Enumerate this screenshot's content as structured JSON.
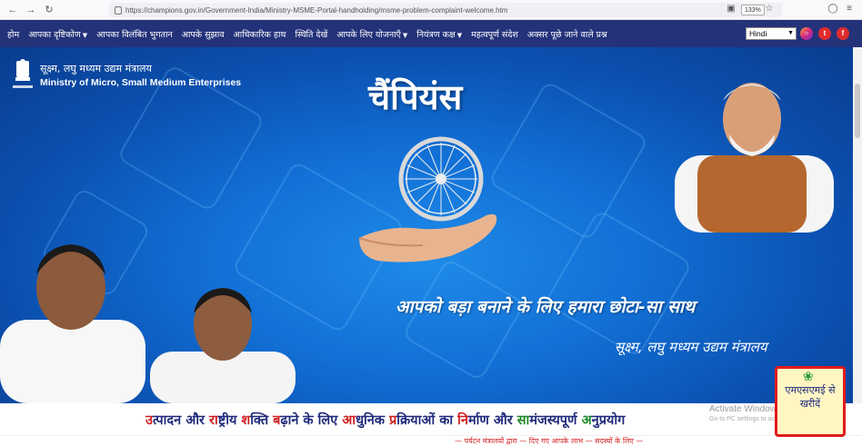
{
  "browser": {
    "url": "https://champions.gov.in/Government-India/Ministry-MSME-Portal-handholding/msme-problem-complaint-welcome.htm",
    "zoom": "133%"
  },
  "nav": {
    "items": [
      "होम",
      "आपका दृष्टिकोण",
      "आपका विलंबित भुगतान",
      "आपके सुझाव",
      "आधिकारिक हाथ",
      "स्थिति देखें",
      "आपके लिए योजनाएँ",
      "नियंत्रण कक्ष",
      "महत्वपूर्ण संदेश",
      "अक्सर पूछे जाने वाले प्रश्न"
    ],
    "language": "Hindi"
  },
  "hero": {
    "ministry_hi": "सूक्ष्म, लघु मध्यम उद्यम मंत्रालय",
    "ministry_en": "Ministry of Micro, Small Medium Enterprises",
    "logo_text": "सत्यमेव जयते",
    "title": "चैंपियंस",
    "tagline": "आपको बड़ा बनाने के लिए हमारा छोटा-सा साथ",
    "sub_tagline": "सूक्ष्म, लघु मध्यम उद्यम मंत्रालय"
  },
  "slogan": [
    {
      "t": "उ",
      "c": "r"
    },
    {
      "t": "त्पादन और ",
      "c": "b"
    },
    {
      "t": "रा",
      "c": "r"
    },
    {
      "t": "ष्ट्रीय ",
      "c": "b"
    },
    {
      "t": "श",
      "c": "r"
    },
    {
      "t": "क्ति ",
      "c": "b"
    },
    {
      "t": "ब",
      "c": "r"
    },
    {
      "t": "ढ़ाने के लिए ",
      "c": "b"
    },
    {
      "t": "आ",
      "c": "r"
    },
    {
      "t": "धुनिक ",
      "c": "b"
    },
    {
      "t": "प्र",
      "c": "r"
    },
    {
      "t": "क्रियाओं का ",
      "c": "b"
    },
    {
      "t": "नि",
      "c": "r"
    },
    {
      "t": "र्माण और ",
      "c": "b"
    },
    {
      "t": "सा",
      "c": "g"
    },
    {
      "t": "मंजस्यपूर्ण ",
      "c": "b"
    },
    {
      "t": "अ",
      "c": "g"
    },
    {
      "t": "नुप्रयोग",
      "c": "b"
    }
  ],
  "windows_watermark": {
    "line1": "Activate Windows",
    "line2": "Go to PC settings to activate Windows."
  },
  "buy_widget": {
    "label": "एमएसएमई से खरीदें"
  },
  "footer_marquee": "— पर्यटन मंत्रालयों द्वारा — दिए गए आपके लाभ — सदस्यों के लिए —",
  "colors": {
    "nav_bg": "#24327a",
    "hero_blue": "#1270d6",
    "accent_red": "#d11f1f",
    "accent_green": "#1f8a2a"
  }
}
